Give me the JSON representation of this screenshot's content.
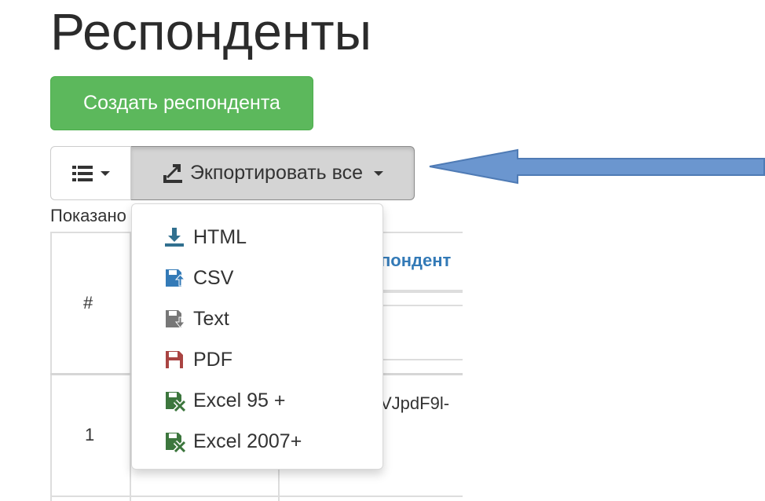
{
  "page": {
    "title": "Респонденты",
    "create_button": "Создать респондента",
    "export_button": "Экпортировать все",
    "shown_text": "Показано"
  },
  "table": {
    "header_number": "#",
    "header_respondent_fragment": "пондент",
    "row_number": "1",
    "row_value_fragment": "VJpdF9l-"
  },
  "export_menu": {
    "items": [
      {
        "label": "HTML",
        "icon": "download-icon",
        "color": "#31708f"
      },
      {
        "label": "CSV",
        "icon": "floppy-upload-icon",
        "color": "#337ab7"
      },
      {
        "label": "Text",
        "icon": "floppy-download-icon",
        "color": "#777777"
      },
      {
        "label": "PDF",
        "icon": "floppy-icon",
        "color": "#a94442"
      },
      {
        "label": "Excel 95 +",
        "icon": "floppy-excel-icon",
        "color": "#3c763d"
      },
      {
        "label": "Excel 2007+",
        "icon": "floppy-excel-icon",
        "color": "#3c763d"
      }
    ]
  },
  "colors": {
    "create_button": "#5cb85c",
    "export_button_bg": "#d4d4d4",
    "link": "#337ab7",
    "arrow": "#6b96cf"
  }
}
